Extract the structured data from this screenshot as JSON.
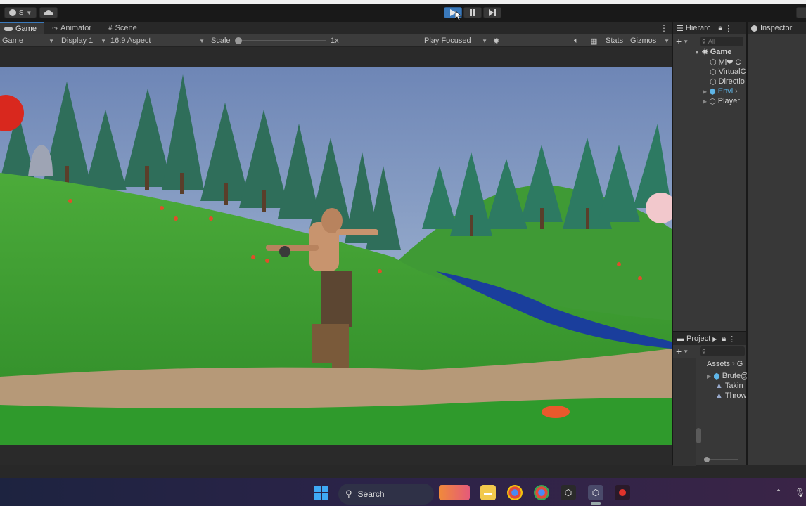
{
  "toolbar": {
    "account_label": "S",
    "cloud_icon": "cloud-icon",
    "play_icon": "play-icon",
    "pause_icon": "pause-icon",
    "step_icon": "step-icon"
  },
  "tabs": [
    {
      "label": "Game",
      "icon": "gamepad-icon"
    },
    {
      "label": "Animator",
      "icon": "animator-icon"
    },
    {
      "label": "Scene",
      "icon": "grid-icon"
    }
  ],
  "game_toolbar": {
    "view_select": "Game",
    "display_select": "Display 1",
    "aspect_select": "16:9 Aspect",
    "scale_label": "Scale",
    "scale_value": "1x",
    "play_mode": "Play Focused",
    "stats_label": "Stats",
    "gizmos_label": "Gizmos"
  },
  "hierarchy": {
    "title": "Hierarc",
    "search_placeholder": "All",
    "root": "Game",
    "items": [
      "Mi❤ C",
      "VirtualC",
      "Directio",
      "Envi",
      "Player"
    ]
  },
  "project": {
    "title": "Project",
    "breadcrumb_root": "Assets",
    "breadcrumb_next": "G",
    "items": [
      "Brute@",
      "Takin",
      "Throw"
    ]
  },
  "inspector": {
    "title": "Inspector"
  },
  "taskbar": {
    "search_label": "Search"
  },
  "colors": {
    "accent": "#3a79bb",
    "play_active": "#4a90c8",
    "prefab_blue": "#5fb6e8"
  }
}
